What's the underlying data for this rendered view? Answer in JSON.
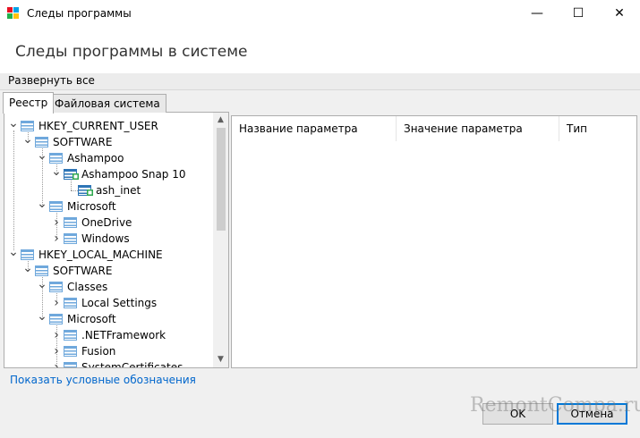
{
  "window": {
    "title": "Следы программы",
    "controls": {
      "minimize": "—",
      "maximize": "☐",
      "close": "✕"
    }
  },
  "header": {
    "text": "Следы программы в системе"
  },
  "toolbar": {
    "expand_all": "Развернуть все"
  },
  "tabs": [
    {
      "label": "Реестр",
      "active": true
    },
    {
      "label": "Файловая система",
      "active": false
    }
  ],
  "tree": {
    "items": [
      {
        "label": "HKEY_CURRENT_USER",
        "level": 0,
        "state": "expanded"
      },
      {
        "label": "SOFTWARE",
        "level": 1,
        "state": "expanded"
      },
      {
        "label": "Ashampoo",
        "level": 2,
        "state": "expanded"
      },
      {
        "label": "Ashampoo Snap 10",
        "level": 3,
        "state": "expanded",
        "marked": true
      },
      {
        "label": "ash_inet",
        "level": 4,
        "state": "leaf",
        "marked": true
      },
      {
        "label": "Microsoft",
        "level": 2,
        "state": "expanded"
      },
      {
        "label": "OneDrive",
        "level": 3,
        "state": "collapsed"
      },
      {
        "label": "Windows",
        "level": 3,
        "state": "collapsed"
      },
      {
        "label": "HKEY_LOCAL_MACHINE",
        "level": 0,
        "state": "expanded"
      },
      {
        "label": "SOFTWARE",
        "level": 1,
        "state": "expanded"
      },
      {
        "label": "Classes",
        "level": 2,
        "state": "expanded"
      },
      {
        "label": "Local Settings",
        "level": 3,
        "state": "collapsed"
      },
      {
        "label": "Microsoft",
        "level": 2,
        "state": "expanded"
      },
      {
        "label": ".NETFramework",
        "level": 3,
        "state": "collapsed"
      },
      {
        "label": "Fusion",
        "level": 3,
        "state": "collapsed"
      },
      {
        "label": "SystemCertificates",
        "level": 3,
        "state": "collapsed"
      }
    ]
  },
  "list": {
    "columns": [
      "Название параметра",
      "Значение параметра",
      "Тип"
    ]
  },
  "legend_link": "Показать условные обозначения",
  "buttons": {
    "ok": "OK",
    "cancel": "Отмена"
  },
  "watermark": "RemontCompa.ru",
  "colors": {
    "folder": "#6fa8dc",
    "folder_marked": "#2e75b6",
    "marker": "#2fa84f",
    "link": "#0066cc",
    "focus": "#0078d7"
  }
}
